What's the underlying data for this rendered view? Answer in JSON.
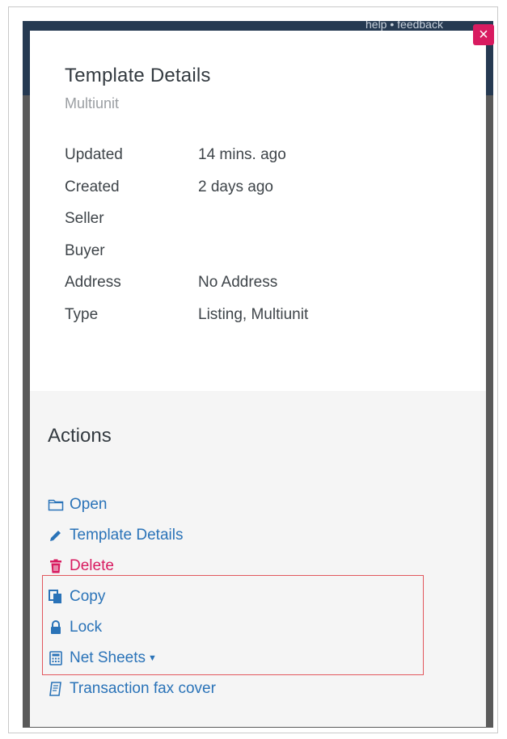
{
  "backdrop": {
    "header_links": "help • feedback"
  },
  "modal": {
    "close_label": "×",
    "title": "Template Details",
    "subtitle": "Multiunit",
    "properties": [
      {
        "label": "Updated",
        "value": "14 mins. ago"
      },
      {
        "label": "Created",
        "value": "2 days ago"
      },
      {
        "label": "Seller",
        "value": ""
      },
      {
        "label": "Buyer",
        "value": ""
      },
      {
        "label": "Address",
        "value": "No Address"
      },
      {
        "label": "Type",
        "value": "Listing, Multiunit"
      }
    ]
  },
  "actions": {
    "title": "Actions",
    "items": [
      {
        "label": "Open",
        "icon": "folder-icon"
      },
      {
        "label": "Template Details",
        "icon": "pencil-icon"
      },
      {
        "label": "Delete",
        "icon": "trash-icon"
      },
      {
        "label": "Copy",
        "icon": "copy-icon"
      },
      {
        "label": "Lock",
        "icon": "lock-icon"
      },
      {
        "label": "Net Sheets",
        "icon": "calculator-icon"
      },
      {
        "label": "Transaction fax cover",
        "icon": "fax-icon"
      }
    ]
  },
  "colors": {
    "accent": "#2a73b8",
    "danger": "#d81b60",
    "highlight": "#e2575d",
    "backdrop_header": "#263a52"
  }
}
